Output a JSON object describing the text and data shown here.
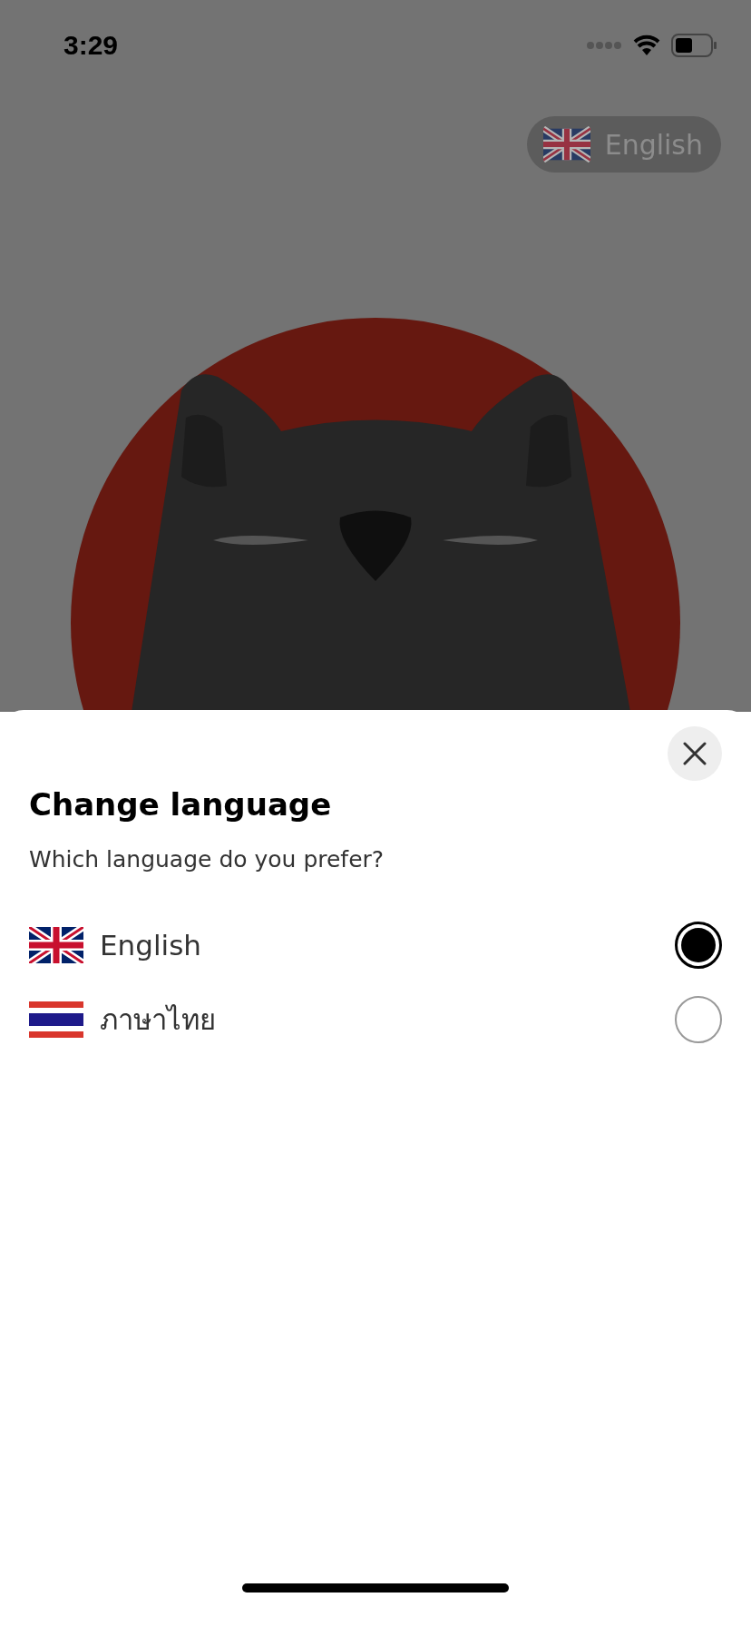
{
  "status_bar": {
    "time": "3:29"
  },
  "language_button": {
    "label": "English",
    "kind": "gb"
  },
  "sheet": {
    "title": "Change language",
    "subtitle": "Which language do you prefer?",
    "options": [
      {
        "label": "English",
        "kind": "gb",
        "selected": true
      },
      {
        "label": "ภาษาไทย",
        "kind": "th",
        "selected": false
      }
    ]
  }
}
